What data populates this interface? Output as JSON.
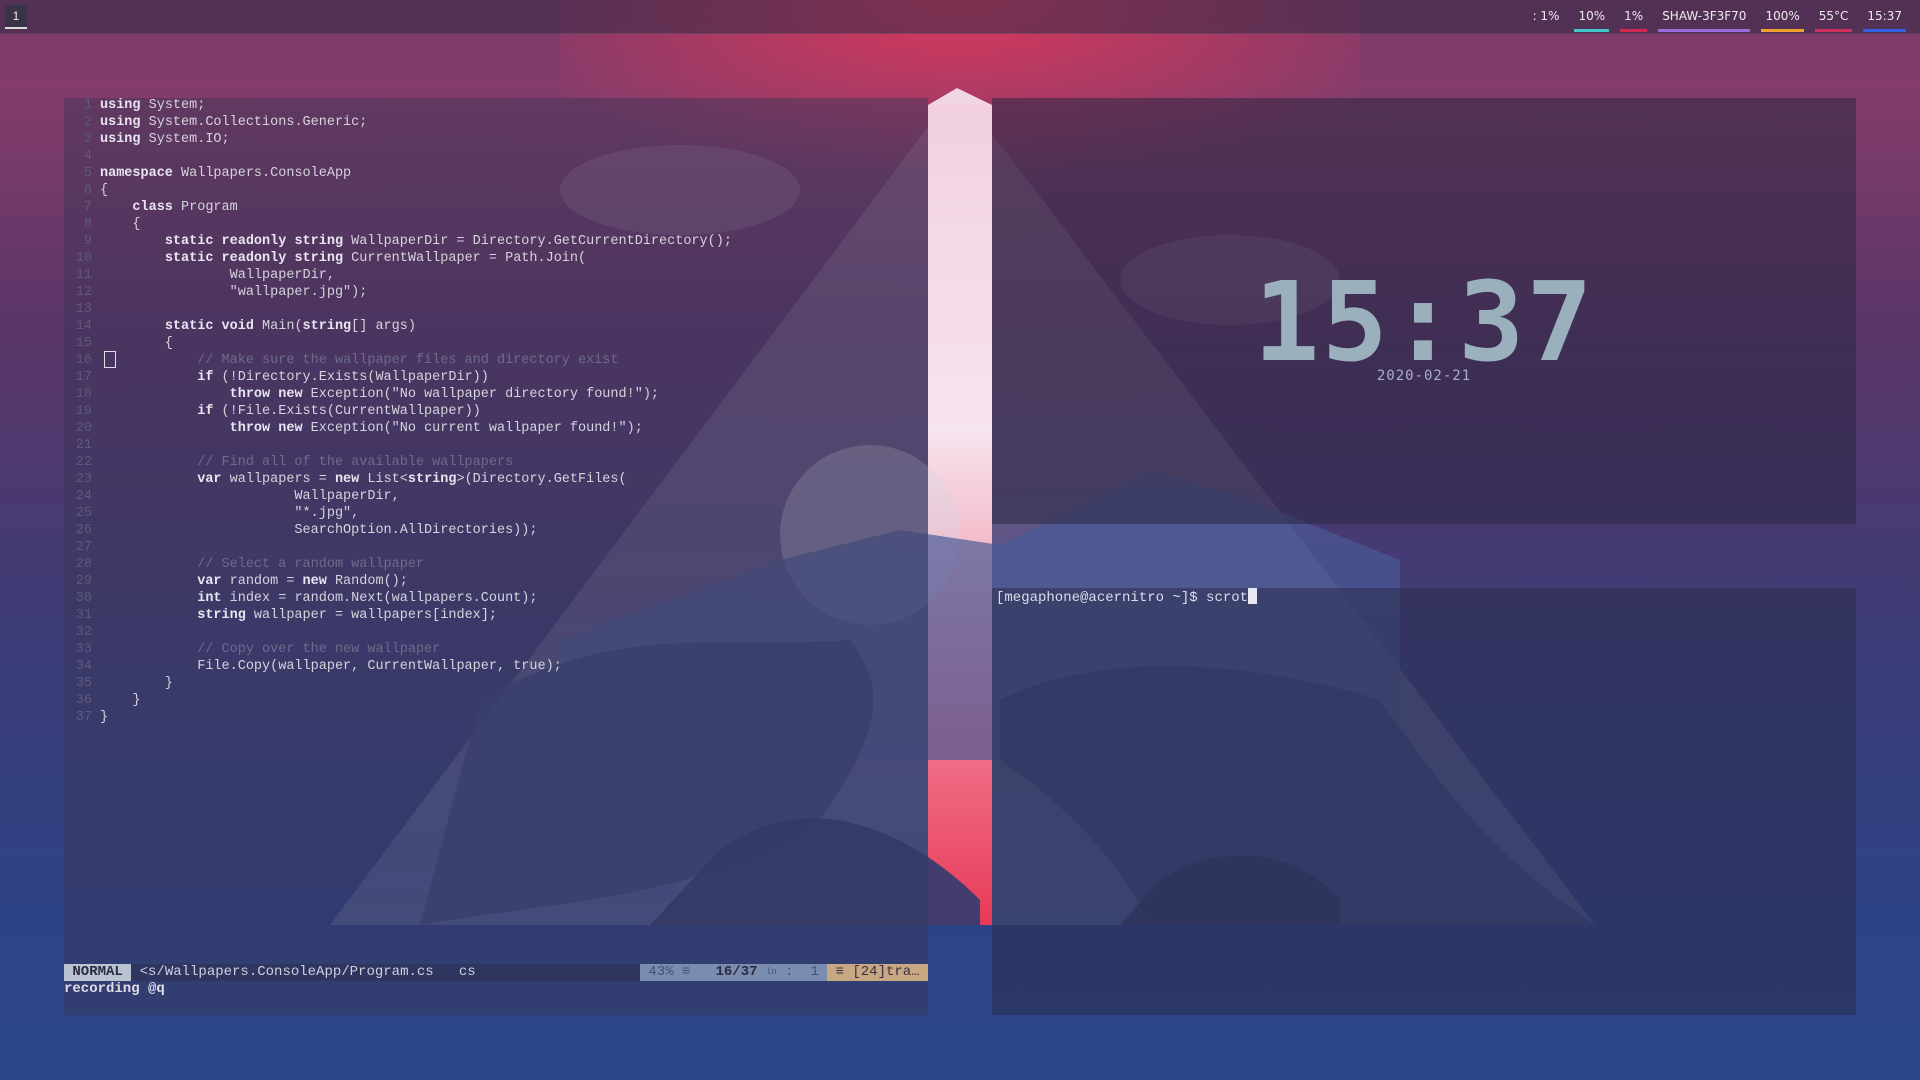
{
  "workspace": {
    "label": "1"
  },
  "status_modules": [
    {
      "name": "cpu",
      "text": ": 1%",
      "color": ""
    },
    {
      "name": "memory",
      "text": "10%",
      "color": "#44c8c8"
    },
    {
      "name": "swap",
      "text": "1%",
      "color": "#d02850"
    },
    {
      "name": "network",
      "text": "SHAW-3F3F70",
      "color": "#9a6ad8"
    },
    {
      "name": "battery",
      "text": "100%",
      "color": "#f0a030"
    },
    {
      "name": "temperature",
      "text": "55°C",
      "color": "#d03060"
    },
    {
      "name": "clock",
      "text": "15:37",
      "color": "#3060e0"
    }
  ],
  "editor": {
    "code_lines": [
      {
        "n": "1",
        "t": "using System;"
      },
      {
        "n": "2",
        "t": "using System.Collections.Generic;"
      },
      {
        "n": "3",
        "t": "using System.IO;"
      },
      {
        "n": "4",
        "t": ""
      },
      {
        "n": "5",
        "t": "namespace Wallpapers.ConsoleApp"
      },
      {
        "n": "6",
        "t": "{"
      },
      {
        "n": "7",
        "t": "    class Program"
      },
      {
        "n": "8",
        "t": "    {"
      },
      {
        "n": "9",
        "t": "        static readonly string WallpaperDir = Directory.GetCurrentDirectory();"
      },
      {
        "n": "10",
        "t": "        static readonly string CurrentWallpaper = Path.Join("
      },
      {
        "n": "11",
        "t": "                WallpaperDir,"
      },
      {
        "n": "12",
        "t": "                \"wallpaper.jpg\");"
      },
      {
        "n": "13",
        "t": ""
      },
      {
        "n": "14",
        "t": "        static void Main(string[] args)"
      },
      {
        "n": "15",
        "t": "        {"
      },
      {
        "n": "16",
        "t": "            // Make sure the wallpaper files and directory exist"
      },
      {
        "n": "17",
        "t": "            if (!Directory.Exists(WallpaperDir))"
      },
      {
        "n": "18",
        "t": "                throw new Exception(\"No wallpaper directory found!\");"
      },
      {
        "n": "19",
        "t": "            if (!File.Exists(CurrentWallpaper))"
      },
      {
        "n": "20",
        "t": "                throw new Exception(\"No current wallpaper found!\");"
      },
      {
        "n": "21",
        "t": ""
      },
      {
        "n": "22",
        "t": "            // Find all of the available wallpapers"
      },
      {
        "n": "23",
        "t": "            var wallpapers = new List<string>(Directory.GetFiles("
      },
      {
        "n": "24",
        "t": "                        WallpaperDir,"
      },
      {
        "n": "25",
        "t": "                        \"*.jpg\","
      },
      {
        "n": "26",
        "t": "                        SearchOption.AllDirectories));"
      },
      {
        "n": "27",
        "t": ""
      },
      {
        "n": "28",
        "t": "            // Select a random wallpaper"
      },
      {
        "n": "29",
        "t": "            var random = new Random();"
      },
      {
        "n": "30",
        "t": "            int index = random.Next(wallpapers.Count);"
      },
      {
        "n": "31",
        "t": "            string wallpaper = wallpapers[index];"
      },
      {
        "n": "32",
        "t": ""
      },
      {
        "n": "33",
        "t": "            // Copy over the new wallpaper"
      },
      {
        "n": "34",
        "t": "            File.Copy(wallpaper, CurrentWallpaper, true);"
      },
      {
        "n": "35",
        "t": "        }"
      },
      {
        "n": "36",
        "t": "    }"
      },
      {
        "n": "37",
        "t": "}"
      }
    ],
    "status": {
      "mode": " NORMAL ",
      "file": " <s/Wallpapers.ConsoleApp/Program.cs ",
      "filetype": "  cs  ",
      "percent": " 43% ≡ ",
      "position": "  16/37 ",
      "ln_icon": "ln",
      "col": " :  1 ",
      "trailing": " ≡ [24]tra… "
    },
    "command_line": "recording @q"
  },
  "clock_widget": {
    "time": "15:37",
    "date": "2020-02-21"
  },
  "terminal": {
    "prompt": "[megaphone@acernitro ~]$ ",
    "command": "scrot"
  }
}
